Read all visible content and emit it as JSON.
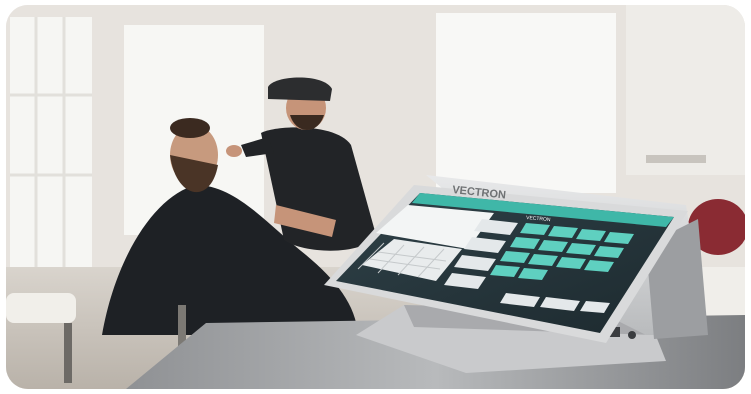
{
  "scene": {
    "description_kind": "photo",
    "brand_text": "VECTRON",
    "screen_brand_text": "VECTRON"
  },
  "colors": {
    "wall": "#e6e2dd",
    "window": "#f7f7f5",
    "cape": "#1f2226",
    "terminal_body": "#d7d8d9",
    "screen_teal": "#4fc4b5",
    "screen_dark": "#2b3a40"
  }
}
